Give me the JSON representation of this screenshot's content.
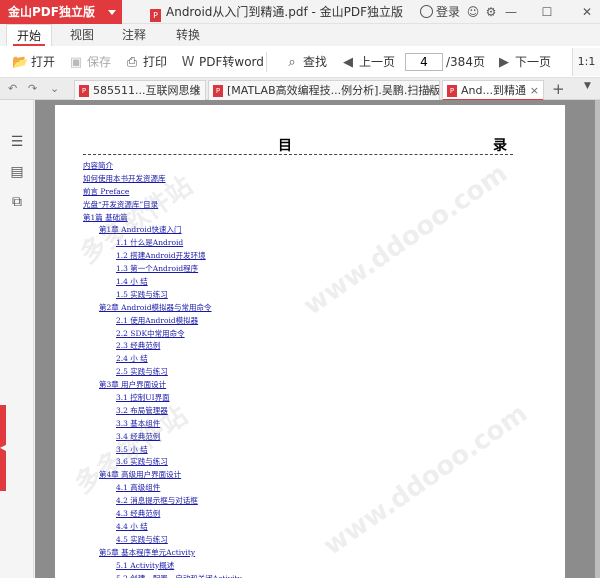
{
  "app": {
    "brand": "金山PDF独立版",
    "window_title": "Android从入门到精通.pdf - 金山PDF独立版",
    "login_label": "登录"
  },
  "menu": {
    "tabs": [
      "开始",
      "视图",
      "注释",
      "转换"
    ]
  },
  "toolbar": {
    "open": "打开",
    "save": "保存",
    "print": "打印",
    "pdf_to_word": "PDF转word",
    "find": "查找",
    "prev_page": "上一页",
    "current_page": "4",
    "total_pages": "/384页",
    "next_page": "下一页",
    "corner": "1:1"
  },
  "doc_tabs": [
    "585511...互联网思维",
    "[MATLAB高效编程技...例分析].吴鹏.扫描版",
    "And...到精通"
  ],
  "toc": {
    "heading_left": "目",
    "heading_right": "录",
    "items": [
      {
        "level": 1,
        "text": "内容简介"
      },
      {
        "level": 1,
        "text": "如何使用本书开发资源库"
      },
      {
        "level": 1,
        "text": "前言 Preface"
      },
      {
        "level": 1,
        "text": "光盘“开发资源库”目录"
      },
      {
        "level": 1,
        "text": "第1篇 基础篇"
      },
      {
        "level": 2,
        "text": "第1章 Android快速入门"
      },
      {
        "level": 3,
        "text": "1.1 什么是Android"
      },
      {
        "level": 3,
        "text": "1.2 搭建Android开发环境"
      },
      {
        "level": 3,
        "text": "1.3 第一个Android程序"
      },
      {
        "level": 3,
        "text": "1.4 小 结"
      },
      {
        "level": 3,
        "text": "1.5 实践与练习"
      },
      {
        "level": 2,
        "text": "第2章 Android模拟器与常用命令"
      },
      {
        "level": 3,
        "text": "2.1 使用Android模拟器"
      },
      {
        "level": 3,
        "text": "2.2 SDK中常用命令"
      },
      {
        "level": 3,
        "text": "2.3 经典范例"
      },
      {
        "level": 3,
        "text": "2.4 小 结"
      },
      {
        "level": 3,
        "text": "2.5 实践与练习"
      },
      {
        "level": 2,
        "text": "第3章 用户界面设计"
      },
      {
        "level": 3,
        "text": "3.1 控制UI界面"
      },
      {
        "level": 3,
        "text": "3.2 布局管理器"
      },
      {
        "level": 3,
        "text": "3.3 基本组件"
      },
      {
        "level": 3,
        "text": "3.4 经典范例"
      },
      {
        "level": 3,
        "text": "3.5 小 结"
      },
      {
        "level": 3,
        "text": "3.6 实践与练习"
      },
      {
        "level": 2,
        "text": "第4章 高级用户界面设计"
      },
      {
        "level": 3,
        "text": "4.1 高级组件"
      },
      {
        "level": 3,
        "text": "4.2 消息提示框与对话框"
      },
      {
        "level": 3,
        "text": "4.3 经典范例"
      },
      {
        "level": 3,
        "text": "4.4 小 结"
      },
      {
        "level": 3,
        "text": "4.5 实践与练习"
      },
      {
        "level": 2,
        "text": "第5章 基本程序单元Activity"
      },
      {
        "level": 3,
        "text": "5.1 Activity概述"
      },
      {
        "level": 3,
        "text": "5.2 创建、配置、启动和关闭Activity"
      }
    ]
  },
  "watermarks": [
    "多多软件站",
    "www.ddooo.com",
    "多多软件站",
    "www.ddooo.com"
  ],
  "colors": {
    "accent": "#e0393e",
    "link": "#1a1aa8",
    "doc_background": "#8c8c8c"
  }
}
